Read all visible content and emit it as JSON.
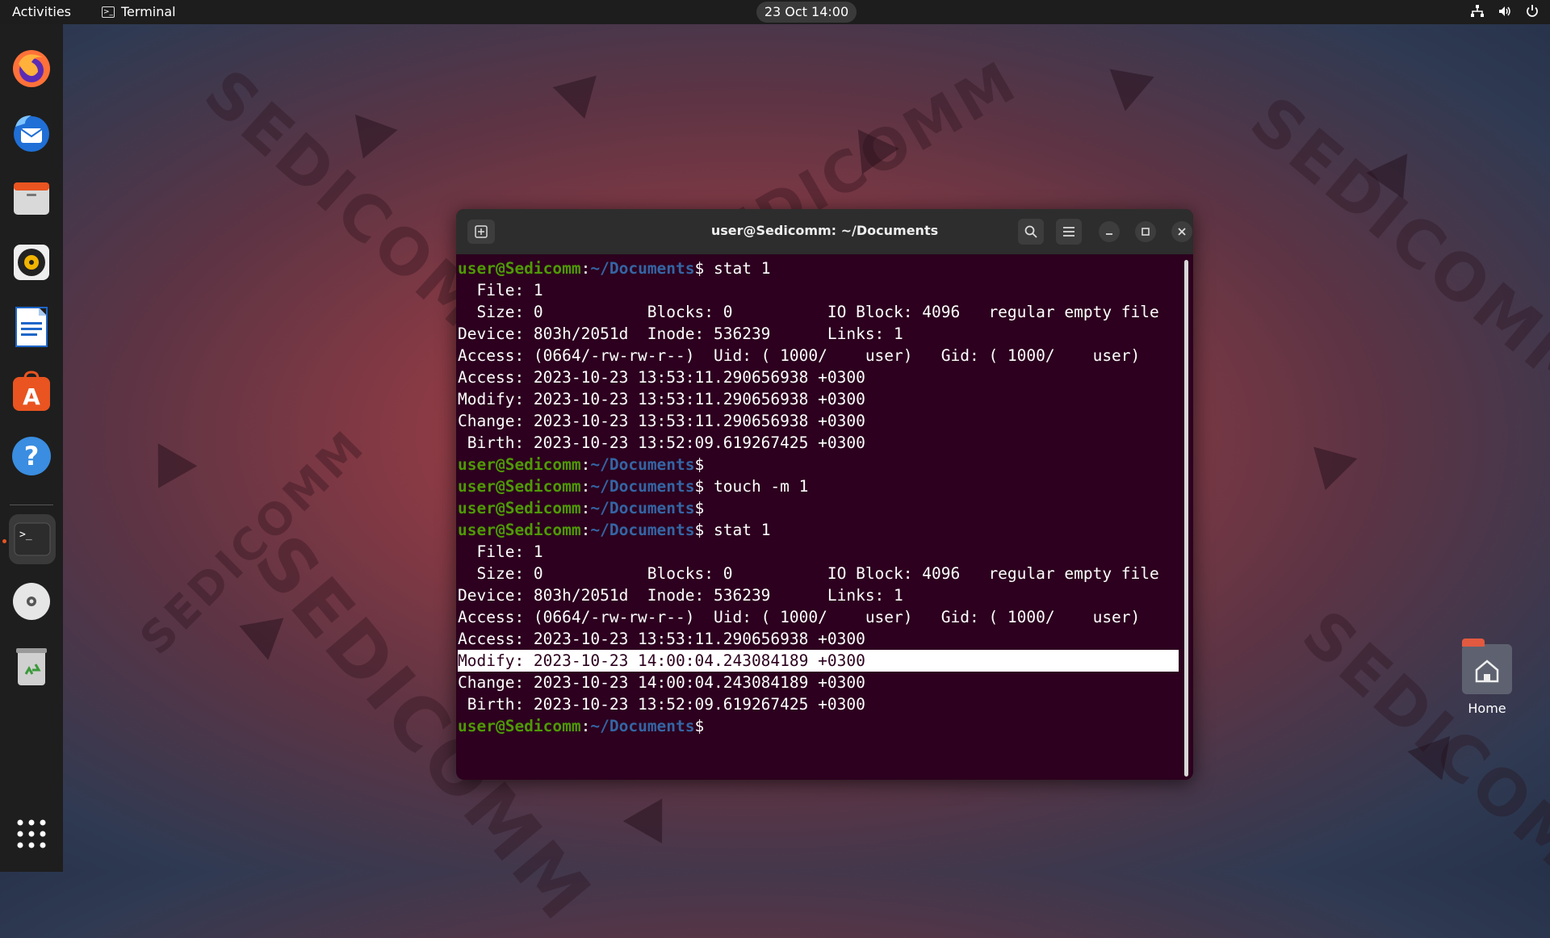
{
  "topbar": {
    "activities": "Activities",
    "app_name": "Terminal",
    "clock": "23 Oct  14:00"
  },
  "dock": {
    "apps": [
      "firefox",
      "thunderbird",
      "files",
      "rhythmbox",
      "libreoffice-writer",
      "app-center",
      "help",
      "terminal",
      "disc",
      "trash",
      "show-apps"
    ]
  },
  "desktop": {
    "home_label": "Home",
    "wallpaper_text": "SEDICOMM"
  },
  "terminal": {
    "title": "user@Sedicomm: ~/Documents",
    "prompt_user": "user@Sedicomm",
    "prompt_path": "~/Documents",
    "lines": [
      {
        "type": "prompt",
        "cmd": " stat 1"
      },
      {
        "type": "output",
        "text": "  File: 1"
      },
      {
        "type": "output",
        "text": "  Size: 0         \tBlocks: 0          IO Block: 4096   regular empty file"
      },
      {
        "type": "output",
        "text": "Device: 803h/2051d\tInode: 536239      Links: 1"
      },
      {
        "type": "output",
        "text": "Access: (0664/-rw-rw-r--)  Uid: ( 1000/    user)   Gid: ( 1000/    user)"
      },
      {
        "type": "output",
        "text": "Access: 2023-10-23 13:53:11.290656938 +0300"
      },
      {
        "type": "output",
        "text": "Modify: 2023-10-23 13:53:11.290656938 +0300"
      },
      {
        "type": "output",
        "text": "Change: 2023-10-23 13:53:11.290656938 +0300"
      },
      {
        "type": "output",
        "text": " Birth: 2023-10-23 13:52:09.619267425 +0300"
      },
      {
        "type": "prompt",
        "cmd": ""
      },
      {
        "type": "prompt",
        "cmd": " touch -m 1"
      },
      {
        "type": "prompt",
        "cmd": ""
      },
      {
        "type": "prompt",
        "cmd": " stat 1"
      },
      {
        "type": "output",
        "text": "  File: 1"
      },
      {
        "type": "output",
        "text": "  Size: 0         \tBlocks: 0          IO Block: 4096   regular empty file"
      },
      {
        "type": "output",
        "text": "Device: 803h/2051d\tInode: 536239      Links: 1"
      },
      {
        "type": "output",
        "text": "Access: (0664/-rw-rw-r--)  Uid: ( 1000/    user)   Gid: ( 1000/    user)"
      },
      {
        "type": "output",
        "text": "Access: 2023-10-23 13:53:11.290656938 +0300"
      },
      {
        "type": "output",
        "text": "Modify: 2023-10-23 14:00:04.243084189 +0300",
        "highlight": true
      },
      {
        "type": "output",
        "text": "Change: 2023-10-23 14:00:04.243084189 +0300"
      },
      {
        "type": "output",
        "text": " Birth: 2023-10-23 13:52:09.619267425 +0300"
      },
      {
        "type": "prompt",
        "cmd": ""
      }
    ]
  }
}
